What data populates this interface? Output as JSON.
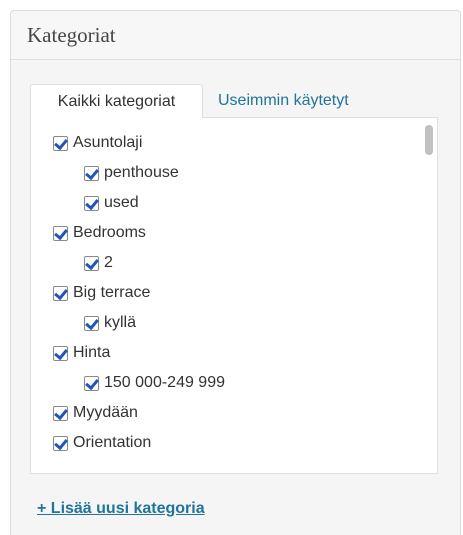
{
  "panel": {
    "title": "Kategoriat"
  },
  "tabs": [
    {
      "label": "Kaikki kategoriat",
      "active": true
    },
    {
      "label": "Useimmin käytetyt",
      "active": false
    }
  ],
  "categories": [
    {
      "label": "Asuntolaji",
      "checked": true,
      "level": 0
    },
    {
      "label": "penthouse",
      "checked": true,
      "level": 1
    },
    {
      "label": "used",
      "checked": true,
      "level": 1
    },
    {
      "label": "Bedrooms",
      "checked": true,
      "level": 0
    },
    {
      "label": "2",
      "checked": true,
      "level": 1
    },
    {
      "label": "Big terrace",
      "checked": true,
      "level": 0
    },
    {
      "label": "kyllä",
      "checked": true,
      "level": 1
    },
    {
      "label": "Hinta",
      "checked": true,
      "level": 0
    },
    {
      "label": "150 000-249 999",
      "checked": true,
      "level": 1
    },
    {
      "label": "Myydään",
      "checked": true,
      "level": 0
    },
    {
      "label": "Orientation",
      "checked": true,
      "level": 0
    }
  ],
  "add_link": {
    "label": "+ Lisää uusi kategoria"
  },
  "colors": {
    "link": "#21759b",
    "checkmark": "#1f56b8"
  }
}
